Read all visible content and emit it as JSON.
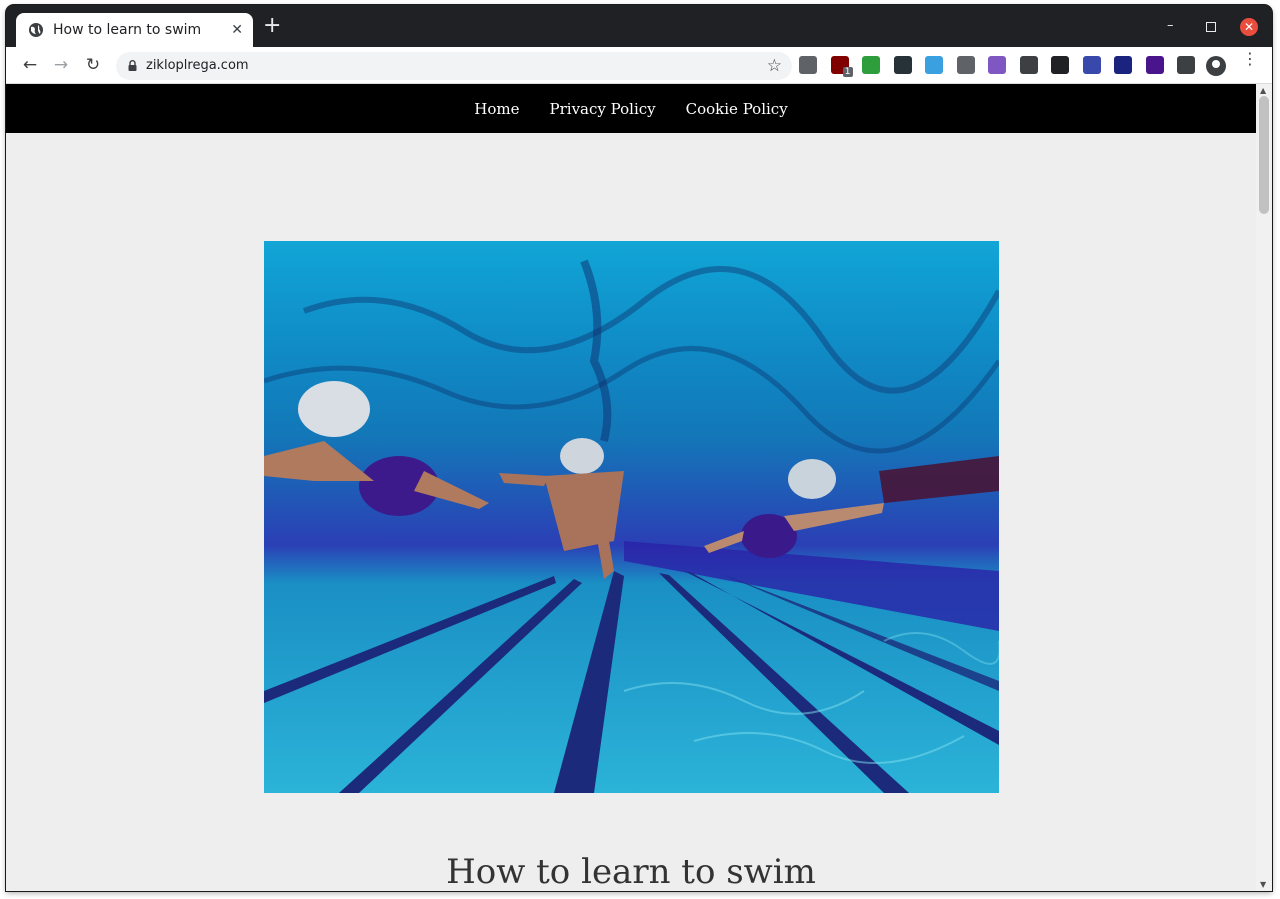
{
  "browser": {
    "tab_title": "How to learn to swim",
    "url": "zikloplrega.com",
    "new_tab_label": "+",
    "close_tab_label": "✕",
    "minimize_label": "–",
    "close_window_label": "✕"
  },
  "extensions": [
    {
      "name": "zip-extension-icon",
      "color": "#5f6368"
    },
    {
      "name": "ublock-origin-icon",
      "color": "#800000"
    },
    {
      "name": "bw-extension-icon",
      "color": "#2e9e3c"
    },
    {
      "name": "dark-square-extension-icon",
      "color": "#263238"
    },
    {
      "name": "screenshot-extension-icon",
      "color": "#3aa0e0"
    },
    {
      "name": "kanji-extension-icon",
      "color": "#5f6368"
    },
    {
      "name": "camera-extension-icon",
      "color": "#7e57c2"
    },
    {
      "name": "search-extension-icon",
      "color": "#3c4043"
    },
    {
      "name": "network-extension-icon",
      "color": "#202124"
    },
    {
      "name": "globe-extension-icon",
      "color": "#3949ab"
    },
    {
      "name": "bottle-extension-icon",
      "color": "#1a237e"
    },
    {
      "name": "purple-circle-extension-icon",
      "color": "#4a148c"
    },
    {
      "name": "puzzle-extensions-icon",
      "color": "#3c4043"
    }
  ],
  "ublock_badge": "1",
  "site": {
    "nav": [
      "Home",
      "Privacy Policy",
      "Cookie Policy"
    ],
    "article_title": "How to learn to swim"
  },
  "colors": {
    "nav_bg": "#000000",
    "page_bg": "#eeeeee",
    "pool_blue": "#0b8fc6"
  }
}
